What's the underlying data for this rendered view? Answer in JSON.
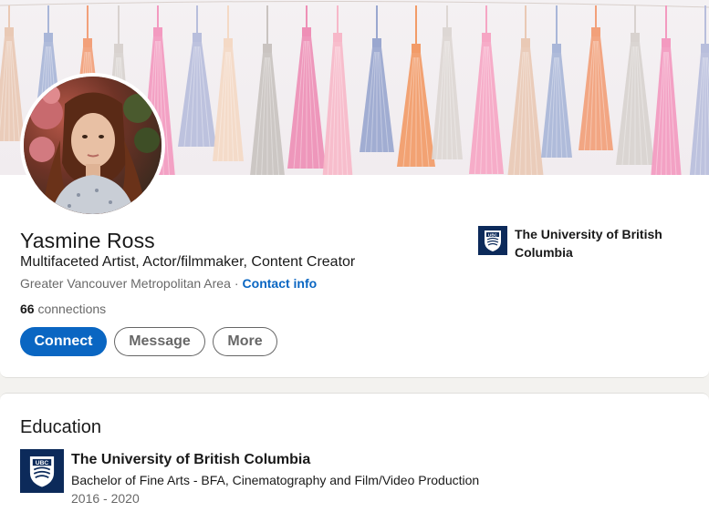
{
  "profile": {
    "name": "Yasmine Ross",
    "headline": "Multifaceted Artist, Actor/filmmaker, Content Creator",
    "location": "Greater Vancouver Metropolitan Area",
    "location_separator": "·",
    "contact_label": "Contact info",
    "connections_count": "66",
    "connections_label": "connections"
  },
  "actions": {
    "connect": "Connect",
    "message": "Message",
    "more": "More"
  },
  "top_school": {
    "name": "The University of British Columbia",
    "logo_text": "UBC"
  },
  "education": {
    "title": "Education",
    "items": [
      {
        "school": "The University of British Columbia",
        "degree": "Bachelor of Fine Arts - BFA, Cinematography and Film/Video Production",
        "dates": "2016 - 2020",
        "logo_text": "UBC"
      }
    ]
  },
  "icons": {
    "school_logo": "ubc-shield-logo"
  },
  "colors": {
    "brand_blue": "#0a66c2",
    "ubc_navy": "#0c2a5a",
    "page_bg": "#f3f2ef"
  }
}
